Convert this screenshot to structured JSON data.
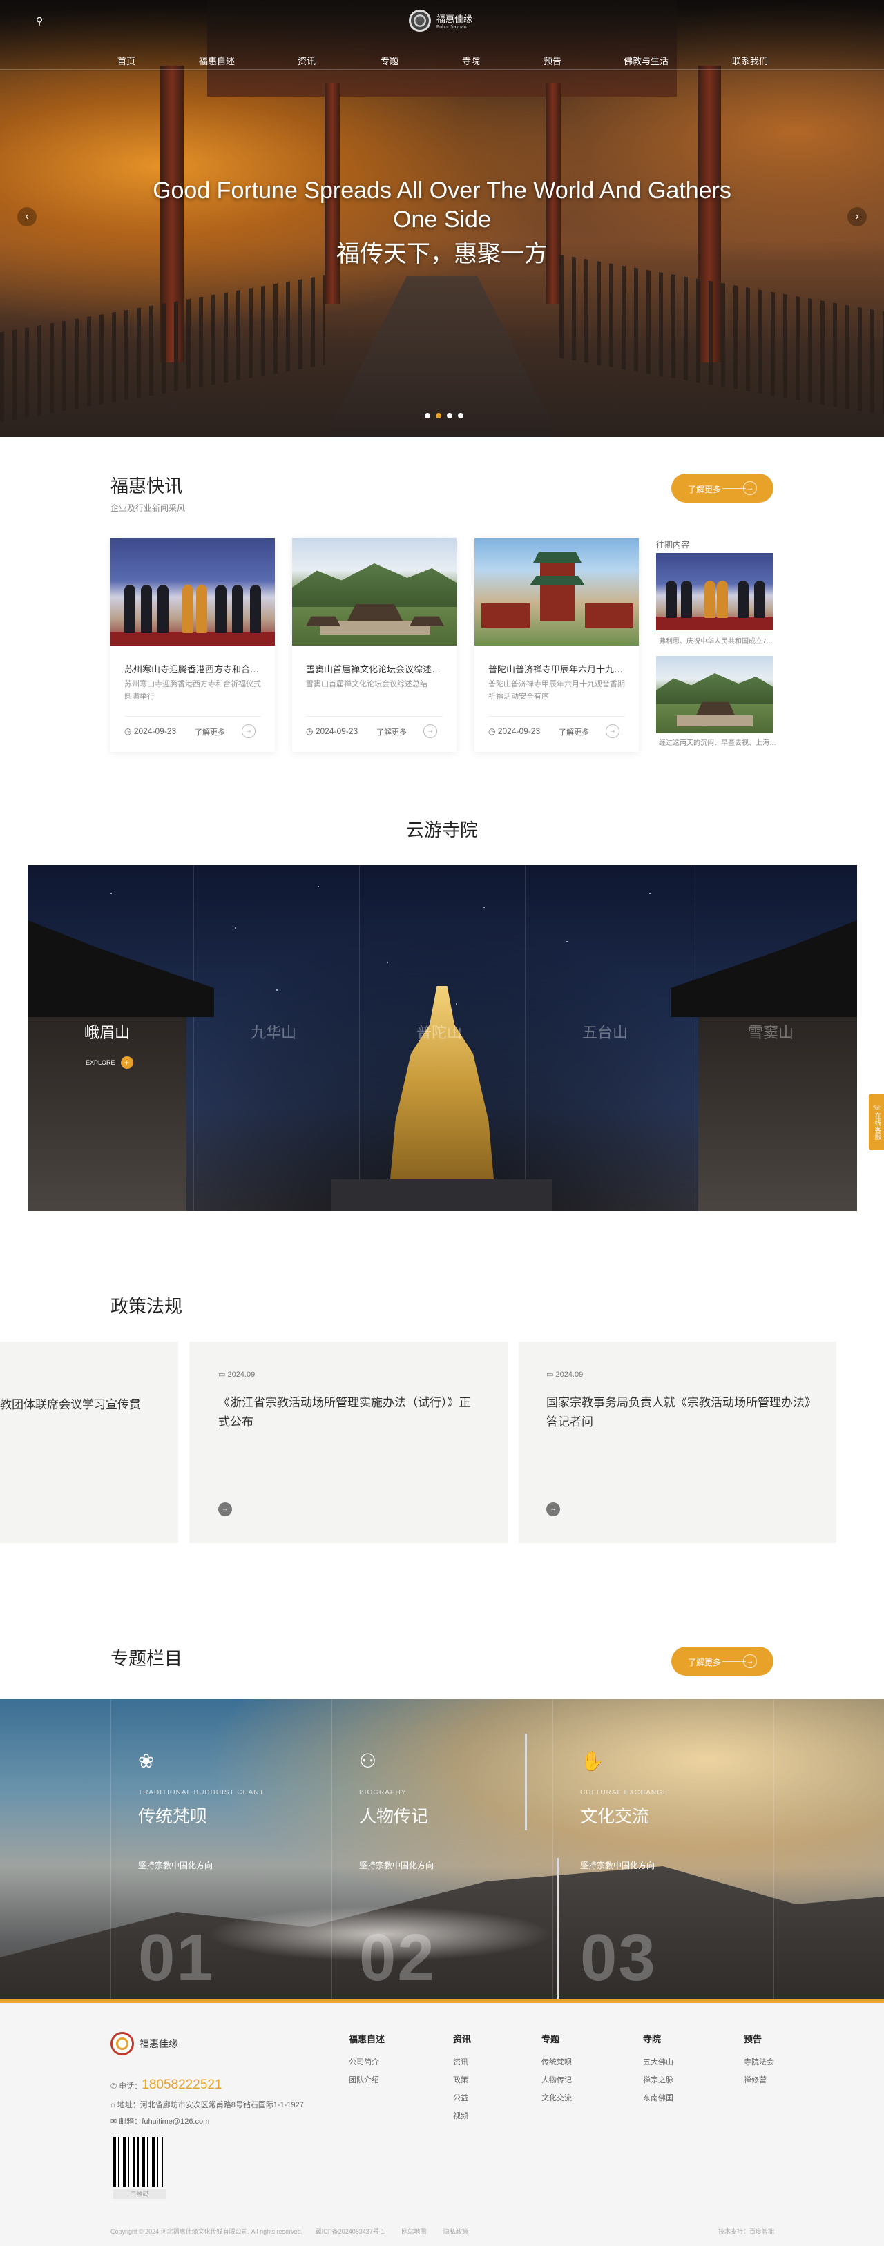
{
  "header": {
    "brand": "福惠佳缘",
    "brand_sub": "Fuhui Jiayuan",
    "nav": [
      "首页",
      "福惠自述",
      "资讯",
      "专题",
      "寺院",
      "预告",
      "佛教与生活",
      "联系我们"
    ]
  },
  "hero": {
    "title_en": "Good Fortune Spreads All Over The World And Gathers One Side",
    "title_cn": "福传天下，惠聚一方",
    "prev": "‹",
    "next": "›",
    "slides": 4,
    "active_slide": 1
  },
  "news": {
    "title": "福惠快讯",
    "subtitle": "企业及行业新闻采风",
    "more": "了解更多",
    "items": [
      {
        "title": "苏州寒山寺迎腾香港西方寺和合祈…",
        "desc": "苏州寒山寺迎腾香港西方寺和合祈福仪式圆满举行",
        "date": "2024-09-23",
        "more": "了解更多"
      },
      {
        "title": "雪窦山首届禅文化论坛会议综述总结",
        "desc": "雪窦山首届禅文化论坛会议综述总结",
        "date": "2024-09-23",
        "more": "了解更多"
      },
      {
        "title": "普陀山普济禅寺甲辰年六月十九观…",
        "desc": "普陀山普济禅寺甲辰年六月十九观音香期祈福活动安全有序",
        "date": "2024-09-23",
        "more": "了解更多"
      }
    ],
    "side_title": "往期内容",
    "side_items": [
      {
        "caption": "弗利思、庆祝中华人民共和国成立75…"
      },
      {
        "caption": "经过这两天的沉闷、早些去视、上海…"
      }
    ]
  },
  "temple": {
    "title": "云游寺院",
    "names": [
      "峨眉山",
      "九华山",
      "普陀山",
      "五台山",
      "雪窦山"
    ],
    "explore": "EXPLORE",
    "explore_icon": "+"
  },
  "policy": {
    "title": "政策法规",
    "cards": [
      {
        "date": "",
        "title": "教团体联席会议学习宣传贯"
      },
      {
        "date": "2024.09",
        "title": "《浙江省宗教活动场所管理实施办法（试行）》正式公布"
      },
      {
        "date": "2024.09",
        "title": "国家宗教事务局负责人就《宗教活动场所管理办法》答记者问"
      }
    ]
  },
  "topic": {
    "title": "专题栏目",
    "more": "了解更多",
    "items": [
      {
        "en": "TRADITIONAL BUDDHIST CHANT",
        "cn": "传统梵呗",
        "link": "坚持宗教中国化方向",
        "num": "01",
        "icon": "lotus-icon"
      },
      {
        "en": "BIOGRAPHY",
        "cn": "人物传记",
        "link": "坚持宗教中国化方向",
        "num": "02",
        "icon": "people-icon"
      },
      {
        "en": "CULTURAL EXCHANGE",
        "cn": "文化交流",
        "link": "坚持宗教中国化方向",
        "num": "03",
        "icon": "handshake-icon"
      }
    ]
  },
  "footer": {
    "brand": "福惠佳缘",
    "phone_label": "电话：",
    "phone": "18058222521",
    "addr_label": "地址：",
    "addr": "河北省廊坊市安次区常甫路8号钻石国际1-1-1927",
    "email_label": "邮箱：",
    "email": "fuhuitime@126.com",
    "qr_label": "二维码",
    "cols": [
      {
        "title": "福惠自述",
        "links": [
          "公司简介",
          "团队介绍"
        ]
      },
      {
        "title": "资讯",
        "links": [
          "资讯",
          "政策",
          "公益",
          "视频"
        ]
      },
      {
        "title": "专题",
        "links": [
          "传统梵呗",
          "人物传记",
          "文化交流"
        ]
      },
      {
        "title": "寺院",
        "links": [
          "五大佛山",
          "禅宗之脉",
          "东南佛国"
        ]
      },
      {
        "title": "预告",
        "links": [
          "寺院法会",
          "禅修营"
        ]
      }
    ],
    "copyright": "Copyright © 2024 河北福惠佳缘文化传媒有限公司. All rights reserved.",
    "icp": "冀ICP备2024083437号-1",
    "links": [
      "网站地图",
      "隐私政策"
    ],
    "tech": "技术支持：百度智能"
  },
  "float_tab": "在线客服",
  "colors": {
    "accent": "#e8a22a"
  }
}
